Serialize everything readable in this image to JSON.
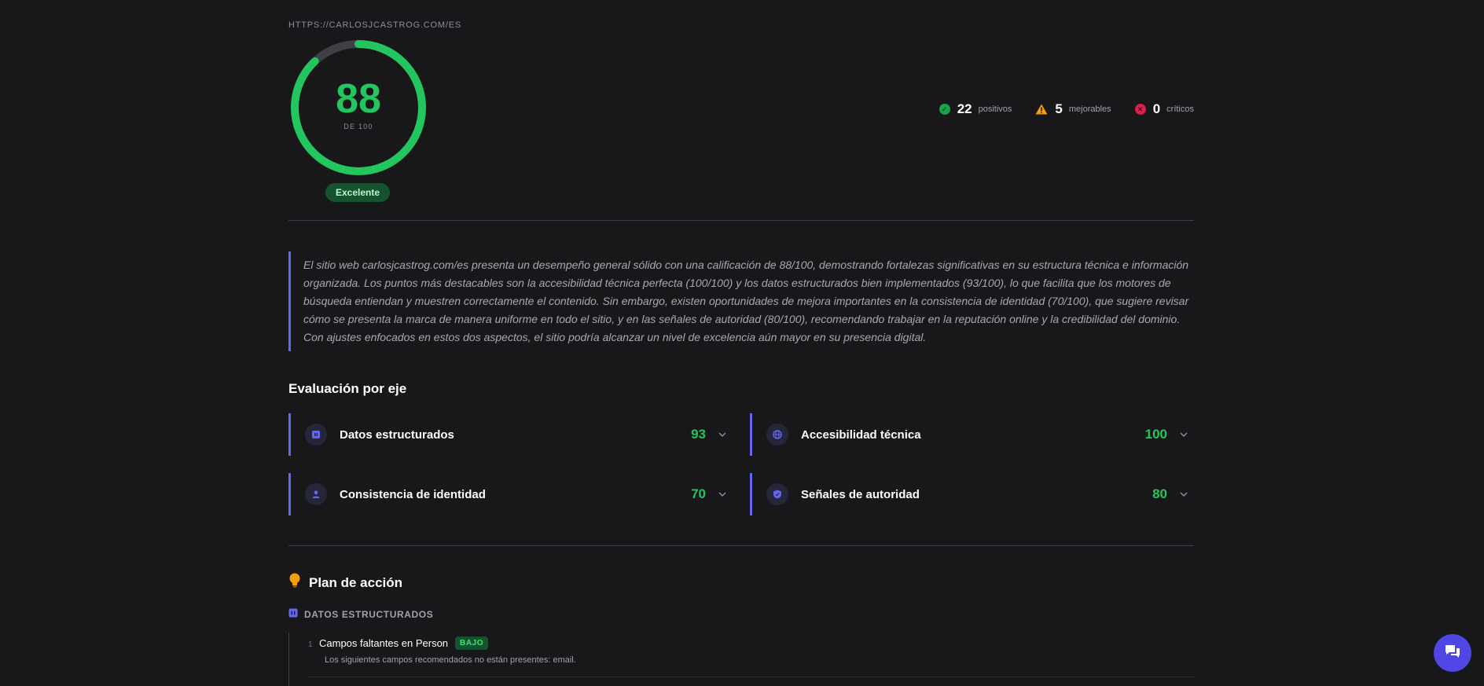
{
  "header": {
    "url": "HTTPS://CARLOSJCASTROG.COM/ES"
  },
  "score": {
    "value": "88",
    "max_label": "DE 100",
    "fraction": 0.88,
    "rating": "Excelente",
    "color": "#22c55e"
  },
  "stats": [
    {
      "count": "22",
      "label": "positivos",
      "icon": "check-circle-icon",
      "color": "#16a34a"
    },
    {
      "count": "5",
      "label": "mejorables",
      "icon": "warning-triangle-icon",
      "color": "#f59e0b"
    },
    {
      "count": "0",
      "label": "críticos",
      "icon": "x-circle-icon",
      "color": "#e11d48"
    }
  ],
  "summary": "El sitio web carlosjcastrog.com/es presenta un desempeño general sólido con una calificación de 88/100, demostrando fortalezas significativas en su estructura técnica e información organizada. Los puntos más destacables son la accesibilidad técnica perfecta (100/100) y los datos estructurados bien implementados (93/100), lo que facilita que los motores de búsqueda entiendan y muestren correctamente el contenido. Sin embargo, existen oportunidades de mejora importantes en la consistencia de identidad (70/100), que sugiere revisar cómo se presenta la marca de manera uniforme en todo el sitio, y en las señales de autoridad (80/100), recomendando trabajar en la reputación online y la credibilidad del dominio. Con ajustes enfocados en estos dos aspectos, el sitio podría alcanzar un nivel de excelencia aún mayor en su presencia digital.",
  "axes_section": {
    "title": "Evaluación por eje",
    "axes": [
      {
        "name": "Datos estructurados",
        "score": "93",
        "icon": "code-icon"
      },
      {
        "name": "Accesibilidad técnica",
        "score": "100",
        "icon": "globe-icon"
      },
      {
        "name": "Consistencia de identidad",
        "score": "70",
        "icon": "user-icon"
      },
      {
        "name": "Señales de autoridad",
        "score": "80",
        "icon": "shield-icon"
      }
    ]
  },
  "plan": {
    "title": "Plan de acción",
    "icon": "lightbulb-icon",
    "category": "DATOS ESTRUCTURADOS",
    "items": [
      {
        "number": "1",
        "title": "Campos faltantes en Person",
        "priority": "BAJO",
        "description": "Los siguientes campos recomendados no están presentes: email."
      }
    ]
  },
  "colors": {
    "accent": "#6366f1",
    "good": "#22c55e",
    "warn": "#f59e0b",
    "bad": "#e11d48",
    "background": "#18181b"
  }
}
